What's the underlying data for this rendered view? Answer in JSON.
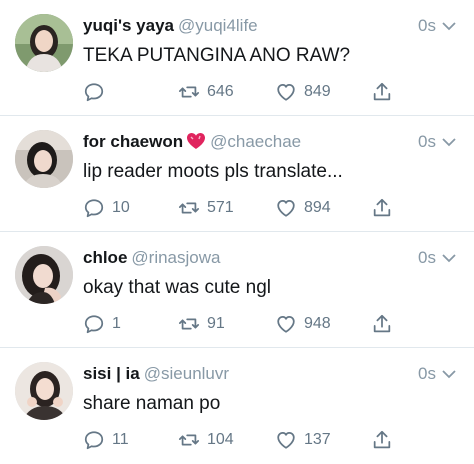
{
  "tweets": [
    {
      "name": "yuqi's yaya",
      "handle": "@yuqi4life",
      "time": "0s",
      "text": "TEKA PUTANGINA ANO RAW?",
      "replies": "",
      "retweets": "646",
      "likes": "849",
      "avatar": "avatar-photo",
      "badge": ""
    },
    {
      "name": "for chaewon",
      "handle": "@chaechae",
      "time": "0s",
      "text": "lip reader moots pls translate...",
      "replies": "10",
      "retweets": "571",
      "likes": "894",
      "avatar": "avatar-photo",
      "badge": "heart-emoji"
    },
    {
      "name": "chloe",
      "handle": "@rinasjowa",
      "time": "0s",
      "text": "okay that was cute ngl",
      "replies": "1",
      "retweets": "91",
      "likes": "948",
      "avatar": "avatar-photo",
      "badge": ""
    },
    {
      "name": "sisi | ia",
      "handle": "@sieunluvr",
      "time": "0s",
      "text": "share naman po",
      "replies": "11",
      "retweets": "104",
      "likes": "137",
      "avatar": "avatar-photo",
      "badge": ""
    }
  ],
  "colors": {
    "text": "#14171a",
    "secondary": "#8899a6",
    "action": "#657786",
    "divider": "#e1e8ed",
    "badge_heart": "#e0245e"
  },
  "icons": {
    "reply": "reply-icon",
    "retweet": "retweet-icon",
    "like": "like-icon",
    "share": "share-icon",
    "more": "chevron-down-icon"
  }
}
